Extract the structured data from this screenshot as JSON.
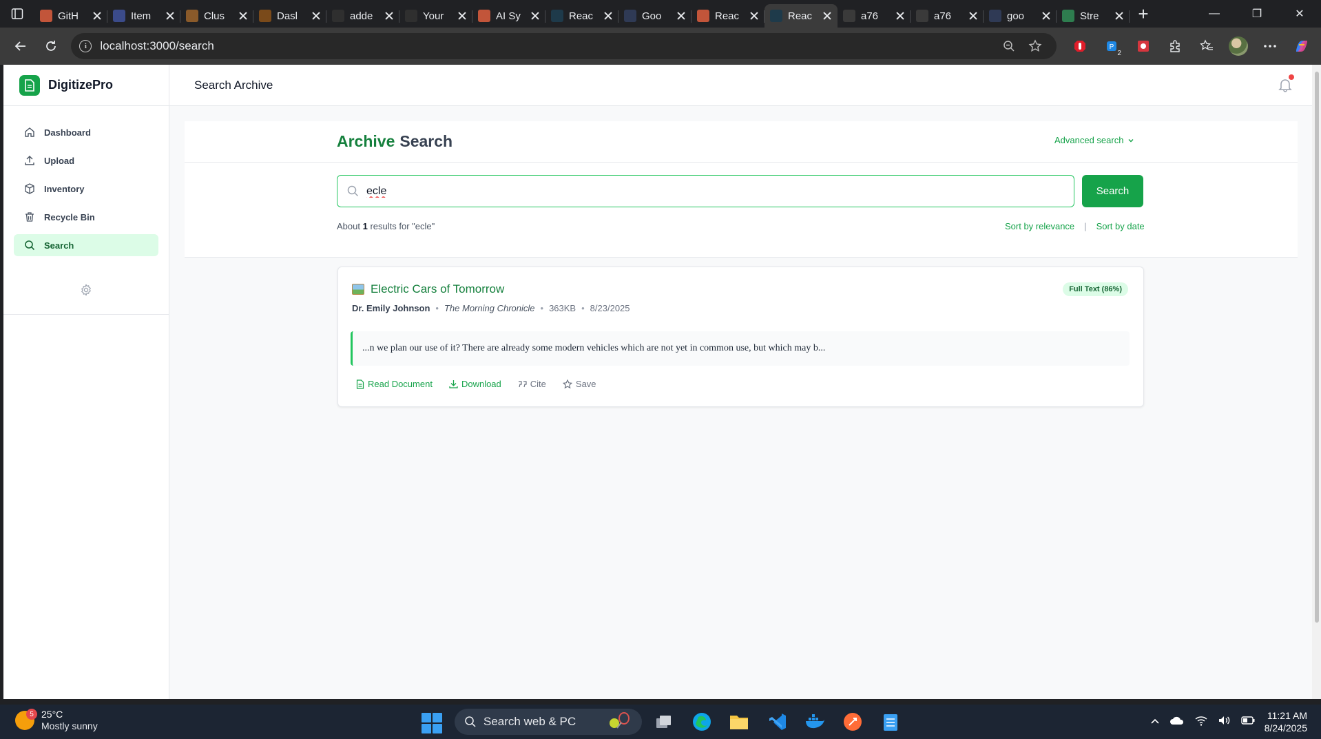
{
  "browser": {
    "tabs": [
      {
        "label": "GitH",
        "favicon_color": "#c2553a"
      },
      {
        "label": "Item",
        "favicon_color": "#3b4b8a"
      },
      {
        "label": "Clus",
        "favicon_color": "#8a5a2a"
      },
      {
        "label": "Dasl",
        "favicon_color": "#7a4a1a"
      },
      {
        "label": "adde",
        "favicon_color": "#2f2f2f"
      },
      {
        "label": "Your",
        "favicon_color": "#2f2f2f"
      },
      {
        "label": "AI Sy",
        "favicon_color": "#c2553a"
      },
      {
        "label": "Reac",
        "favicon_color": "#1e3a4a"
      },
      {
        "label": "Goo",
        "favicon_color": "#2f3a55"
      },
      {
        "label": "Reac",
        "favicon_color": "#c2553a"
      },
      {
        "label": "Reac",
        "favicon_color": "#1e3a4a",
        "active": true
      },
      {
        "label": "a76",
        "favicon_color": "#3a3a3a"
      },
      {
        "label": "a76",
        "favicon_color": "#3a3a3a"
      },
      {
        "label": "goo",
        "favicon_color": "#2f3a55"
      },
      {
        "label": "Stre",
        "favicon_color": "#2e7d4f"
      }
    ],
    "url": "localhost:3000/search",
    "extension_badge": "2"
  },
  "app": {
    "brand": "DigitizePro",
    "nav": [
      {
        "label": "Dashboard",
        "icon": "home-icon"
      },
      {
        "label": "Upload",
        "icon": "upload-icon"
      },
      {
        "label": "Inventory",
        "icon": "box-icon"
      },
      {
        "label": "Recycle Bin",
        "icon": "trash-icon"
      },
      {
        "label": "Search",
        "icon": "search-icon",
        "active": true
      }
    ],
    "topbar_title": "Search Archive",
    "accent_color": "#16a34a"
  },
  "search": {
    "title_accent": "Archive",
    "title_rest": "Search",
    "advanced_label": "Advanced search",
    "query": "ecle",
    "button_label": "Search",
    "results_prefix": "About",
    "results_count": "1",
    "results_suffix": "results for \"ecle\"",
    "sort_relevance": "Sort by relevance",
    "sort_separator": "|",
    "sort_date": "Sort by date"
  },
  "results": [
    {
      "title": "Electric Cars of Tomorrow",
      "badge": "Full Text (86%)",
      "author": "Dr. Emily Johnson",
      "publication": "The Morning Chronicle",
      "size": "363KB",
      "date": "8/23/2025",
      "meta_separator": "•",
      "snippet": "...n we plan our use of it? There are already some modern vehicles which are not yet in common use, but which may b...",
      "actions": {
        "read": "Read Document",
        "download": "Download",
        "cite": "Cite",
        "save": "Save"
      }
    }
  ],
  "taskbar": {
    "weather_badge": "5",
    "temperature": "25°C",
    "condition": "Mostly sunny",
    "search_placeholder": "Search web & PC",
    "time": "11:21 AM",
    "date": "8/24/2025"
  }
}
